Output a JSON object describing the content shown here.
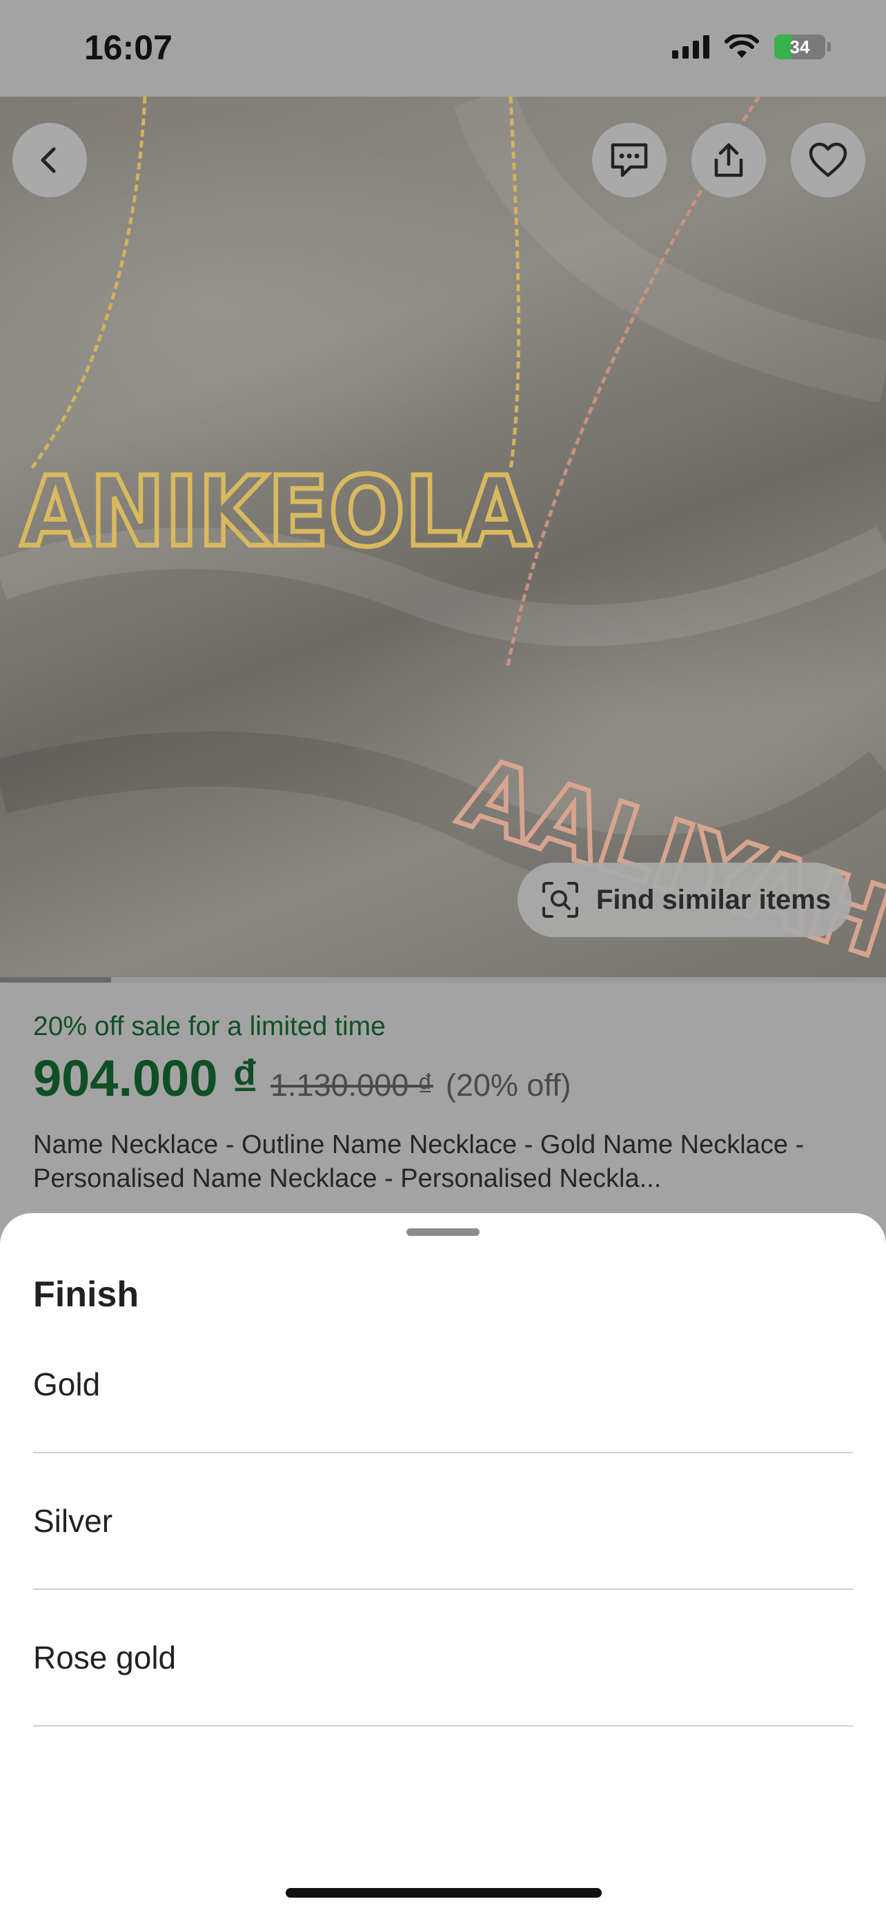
{
  "status_bar": {
    "time": "16:07",
    "battery": "34"
  },
  "hero": {
    "find_similar_label": "Find similar items",
    "image_progress": 0.125,
    "necklace_names": [
      "ANIKEOLA",
      "AALIYAH"
    ]
  },
  "product": {
    "sale_text": "20% off sale for a limited time",
    "price": "904.000 ₫",
    "original_price": "1.130.000 ₫",
    "discount": "(20% off)",
    "title": "Name Necklace - Outline Name Necklace - Gold Name Necklace - Personalised Name Necklace - Personalised Neckla..."
  },
  "sheet": {
    "title": "Finish",
    "options": [
      "Gold",
      "Silver",
      "Rose gold"
    ]
  },
  "icons": {
    "back": "chevron-left-icon",
    "message": "message-icon",
    "share": "share-icon",
    "favorite": "heart-icon",
    "visual_search": "visual-search-icon"
  },
  "colors": {
    "sale_green": "#0f4f25",
    "gold": "#d4b25a",
    "rose_gold": "#c8927c"
  }
}
